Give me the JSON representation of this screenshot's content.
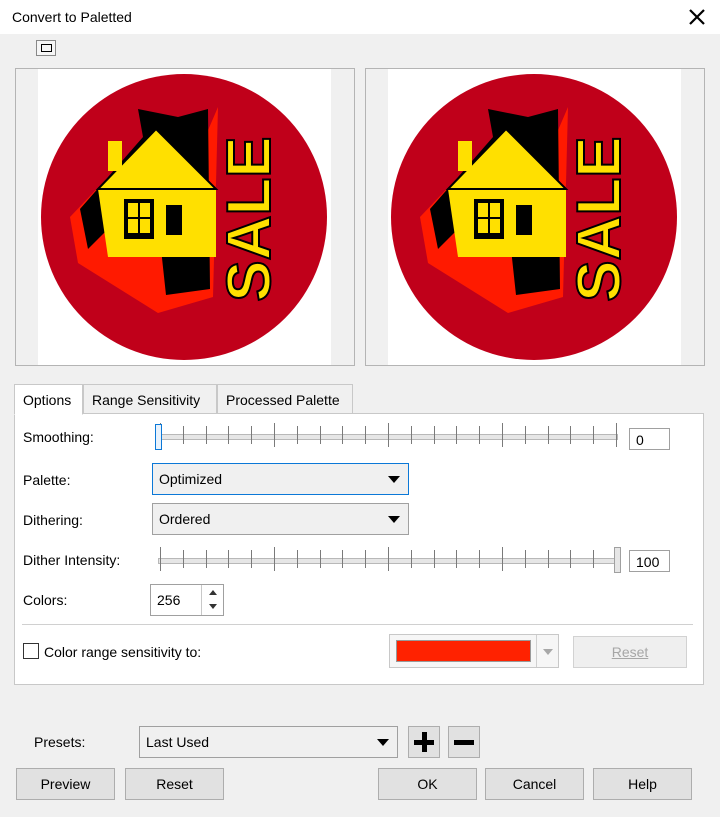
{
  "window": {
    "title": "Convert to Paletted"
  },
  "preview": {
    "sign_text": "SALE"
  },
  "tabs": [
    {
      "label": "Options",
      "active": true
    },
    {
      "label": "Range Sensitivity",
      "active": false
    },
    {
      "label": "Processed Palette",
      "active": false
    }
  ],
  "options": {
    "smoothing": {
      "label": "Smoothing:",
      "value": "0",
      "level": 0
    },
    "palette": {
      "label": "Palette:",
      "value": "Optimized"
    },
    "dithering": {
      "label": "Dithering:",
      "value": "Ordered"
    },
    "dither_intensity": {
      "label": "Dither Intensity:",
      "value": "100",
      "level": 1
    },
    "colors": {
      "label": "Colors:",
      "value": "256"
    },
    "color_range": {
      "label": "Color range sensitivity to:",
      "checked": false,
      "color": "#ff2200"
    },
    "reset_label": "Reset"
  },
  "presets": {
    "label": "Presets:",
    "value": "Last Used"
  },
  "buttons": {
    "preview": "Preview",
    "reset": "Reset",
    "ok": "OK",
    "cancel": "Cancel",
    "help": "Help"
  },
  "colors": {
    "accent": "#0b78d7",
    "sign_red": "#c0001a",
    "sign_yellow": "#ffe000"
  }
}
